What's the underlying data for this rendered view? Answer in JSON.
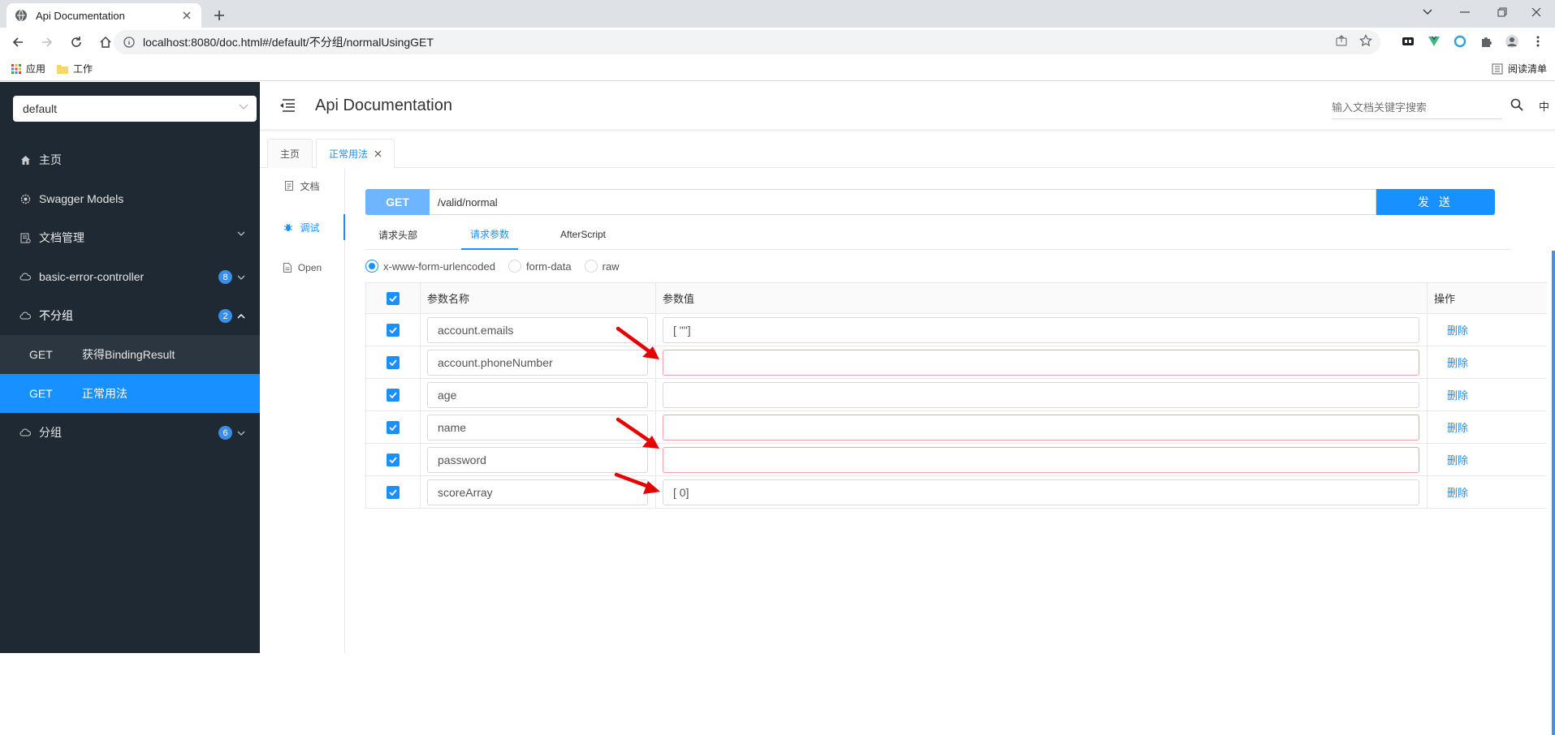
{
  "browser": {
    "tab_title": "Api Documentation",
    "url": "localhost:8080/doc.html#/default/不分组/normalUsingGET",
    "bookmarks": [
      "应用",
      "工作"
    ],
    "reading_list": "阅读清单"
  },
  "sidebar": {
    "group_select": "default",
    "items": [
      {
        "label": "主页",
        "icon": "home-icon"
      },
      {
        "label": "Swagger Models",
        "icon": "gear-icon"
      },
      {
        "label": "文档管理",
        "icon": "doc-manage-icon"
      },
      {
        "label": "basic-error-controller",
        "icon": "cloud-icon",
        "badge": "8"
      },
      {
        "label": "不分组",
        "icon": "cloud-icon",
        "badge": "2"
      },
      {
        "label": "分组",
        "icon": "cloud-icon",
        "badge": "6"
      }
    ],
    "sub_items": [
      {
        "method": "GET",
        "label": "获得BindingResult"
      },
      {
        "method": "GET",
        "label": "正常用法"
      }
    ]
  },
  "header": {
    "title": "Api Documentation",
    "search_placeholder": "输入文档关键字搜索",
    "lang": "中"
  },
  "page_tabs": [
    {
      "label": "主页"
    },
    {
      "label": "正常用法"
    }
  ],
  "side_tabs": [
    {
      "label": "文档"
    },
    {
      "label": "调试"
    },
    {
      "label": "Open"
    }
  ],
  "request": {
    "method": "GET",
    "path": "/valid/normal",
    "send_label": "发 送"
  },
  "sub_tabs": [
    "请求头部",
    "请求参数",
    "AfterScript"
  ],
  "content_types": [
    "x-www-form-urlencoded",
    "form-data",
    "raw"
  ],
  "params_table": {
    "headers": {
      "name": "参数名称",
      "value": "参数值",
      "op": "操作"
    },
    "rows": [
      {
        "name": "account.emails",
        "value": "[  \"\"]",
        "delete": "删除"
      },
      {
        "name": "account.phoneNumber",
        "value": "",
        "delete": "删除"
      },
      {
        "name": "age",
        "value": "",
        "delete": "删除"
      },
      {
        "name": "name",
        "value": "",
        "delete": "删除"
      },
      {
        "name": "password",
        "value": "",
        "delete": "删除"
      },
      {
        "name": "scoreArray",
        "value": "[  0]",
        "delete": "删除"
      }
    ]
  },
  "colors": {
    "primary": "#1890ff",
    "sidebar_bg": "#1f2933",
    "method_get": "#6fb4ff",
    "arrow": "#e60000",
    "error_border": "#f5a3a3"
  }
}
